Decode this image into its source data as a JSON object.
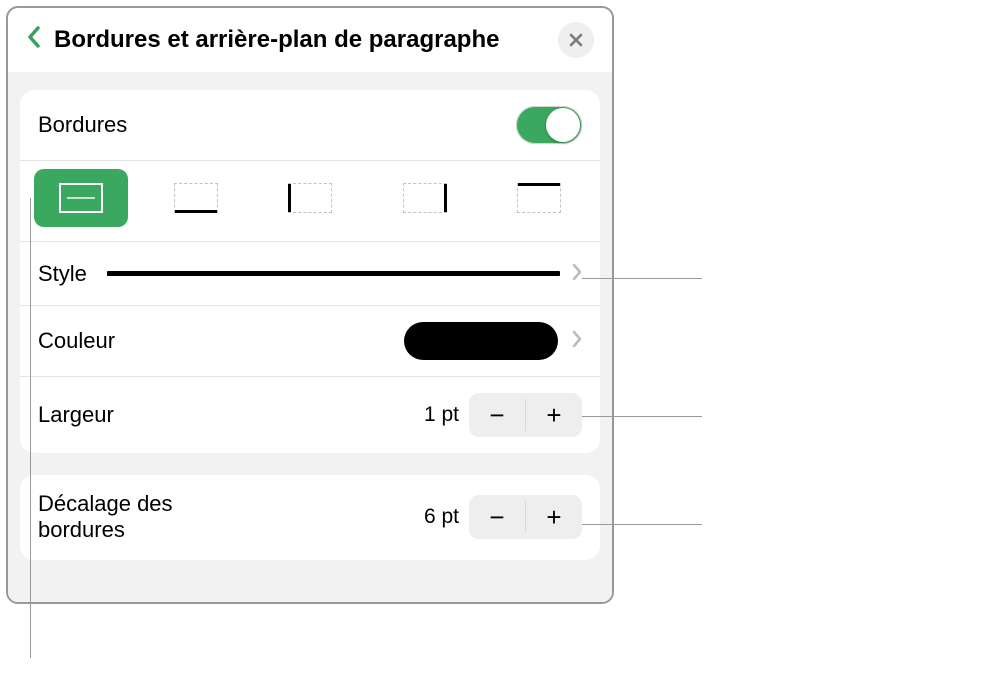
{
  "header": {
    "title": "Bordures et arrière-plan de paragraphe"
  },
  "sections": {
    "borders_toggle_label": "Bordures",
    "style_label": "Style",
    "color_label": "Couleur",
    "width_label": "Largeur",
    "width_value": "1 pt",
    "offset_label": "Décalage des bordures",
    "offset_value": "6 pt"
  },
  "icons": {
    "minus": "−",
    "plus": "+"
  }
}
